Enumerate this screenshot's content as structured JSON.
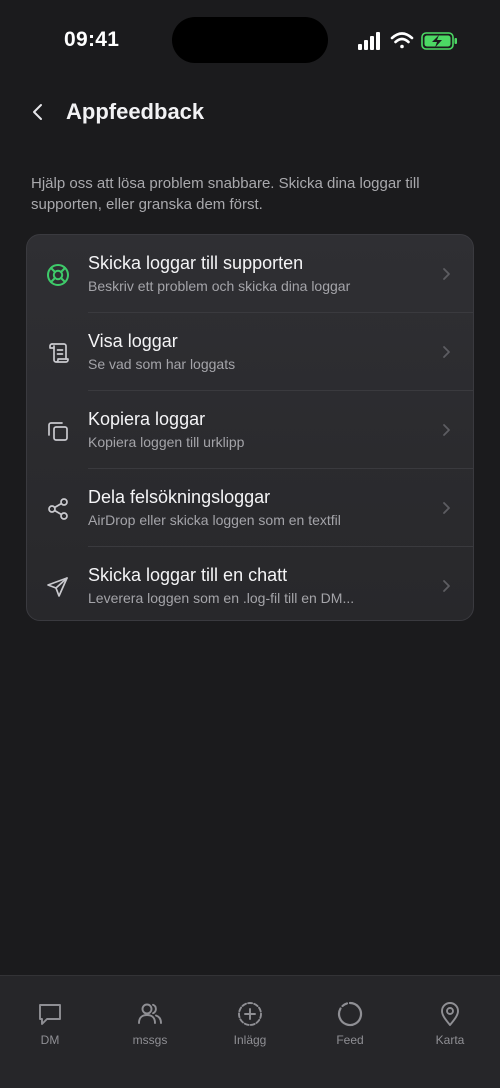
{
  "status_bar": {
    "time": "09:41"
  },
  "header": {
    "title": "Appfeedback"
  },
  "intro_text": "Hjälp oss att lösa problem snabbare. Skicka dina loggar till supporten, eller granska dem först.",
  "items": [
    {
      "title": "Skicka loggar till supporten",
      "subtitle": "Beskriv ett problem och skicka dina loggar",
      "icon": "lifebuoy-icon"
    },
    {
      "title": "Visa loggar",
      "subtitle": "Se vad som har loggats",
      "icon": "scroll-icon"
    },
    {
      "title": "Kopiera loggar",
      "subtitle": "Kopiera loggen till urklipp",
      "icon": "copy-icon"
    },
    {
      "title": "Dela felsökningsloggar",
      "subtitle": "AirDrop eller skicka loggen som en textfil",
      "icon": "share-icon"
    },
    {
      "title": "Skicka loggar till en chatt",
      "subtitle": "Leverera loggen som en .log-fil till en DM...",
      "icon": "send-icon"
    }
  ],
  "tabs": [
    {
      "label": "DM",
      "icon": "chat-bubble-icon"
    },
    {
      "label": "mssgs",
      "icon": "users-icon"
    },
    {
      "label": "Inlägg",
      "icon": "plus-circle-icon"
    },
    {
      "label": "Feed",
      "icon": "circle-icon"
    },
    {
      "label": "Karta",
      "icon": "map-pin-icon"
    }
  ],
  "colors": {
    "background": "#1b1b1d",
    "card": "#2c2c30",
    "accent_green": "#3ecb6a",
    "battery_green": "#4cd964",
    "muted_text": "#a4a4a9"
  }
}
